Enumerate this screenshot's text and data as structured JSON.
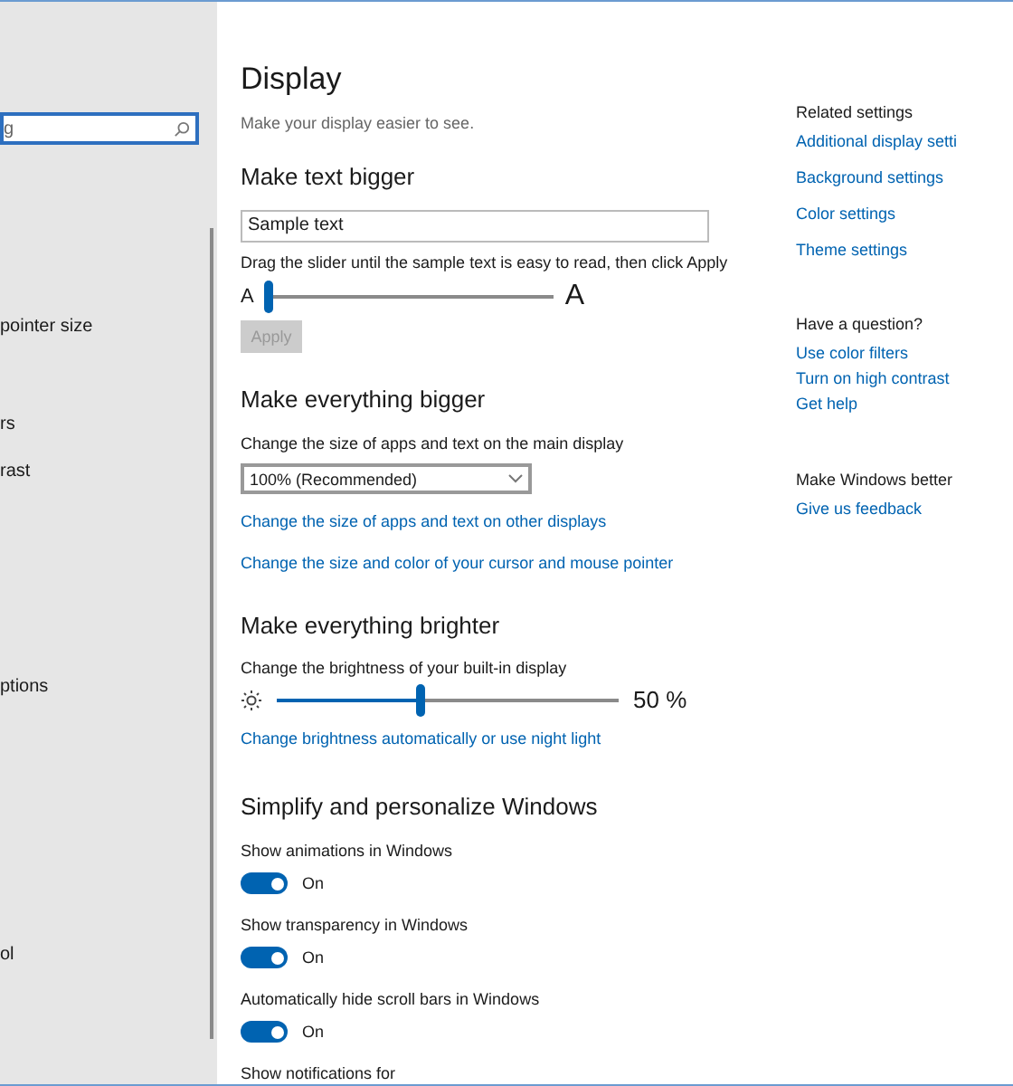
{
  "sidebar": {
    "search": {
      "placeholder": "g"
    },
    "items": [
      {
        "label": "pointer size"
      },
      {
        "label": "rs"
      },
      {
        "label": "rast"
      },
      {
        "label": "ptions"
      },
      {
        "label": "ol"
      }
    ]
  },
  "page": {
    "title": "Display",
    "subtitle": "Make your display easier to see."
  },
  "text_size": {
    "heading": "Make text bigger",
    "sample": "Sample text",
    "hint": "Drag the slider until the sample text is easy to read, then click Apply",
    "small_label": "A",
    "large_label": "A",
    "level": 0,
    "apply": {
      "label": "Apply",
      "disabled": true
    }
  },
  "scale": {
    "heading": "Make everything bigger",
    "label": "Change the size of apps and text on the main display",
    "value": "100% (Recommended)",
    "links": [
      "Change the size of apps and text on other displays",
      "Change the size and color of your cursor and mouse pointer"
    ]
  },
  "brightness": {
    "heading": "Make everything brighter",
    "label": "Change the brightness of your built-in display",
    "level": 0.42,
    "reading": "50 %",
    "link": "Change brightness automatically or use night light"
  },
  "personalize": {
    "heading": "Simplify and personalize Windows",
    "toggles": [
      {
        "label": "Show animations in Windows",
        "on": true,
        "state": "On"
      },
      {
        "label": "Show transparency in Windows",
        "on": true,
        "state": "On"
      },
      {
        "label": "Automatically hide scroll bars in Windows",
        "on": true,
        "state": "On"
      }
    ],
    "next_label": "Show notifications for"
  },
  "related": [
    {
      "heading": "Related settings",
      "links": [
        "Additional display setti",
        "Background settings",
        "Color settings",
        "Theme settings"
      ]
    },
    {
      "heading": "Have a question?",
      "links": [
        "Use color filters",
        "Turn on high contrast",
        "Get help"
      ]
    },
    {
      "heading": "Make Windows better",
      "links": [
        "Give us feedback"
      ]
    }
  ]
}
